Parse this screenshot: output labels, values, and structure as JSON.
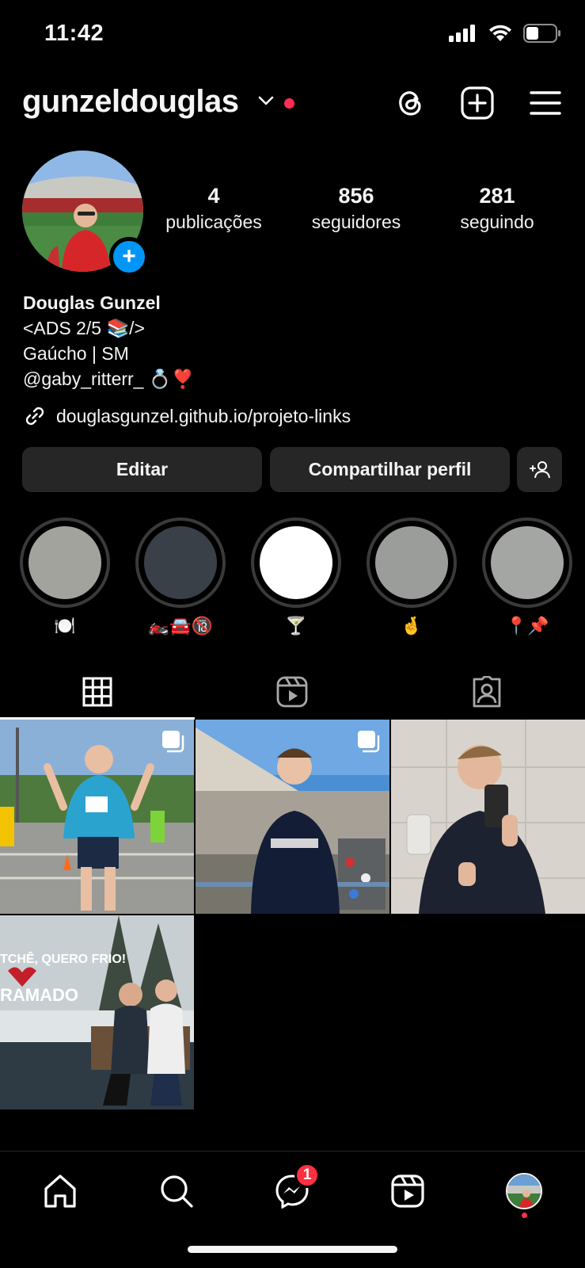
{
  "status": {
    "time": "11:42"
  },
  "header": {
    "username": "gunzeldouglas"
  },
  "profile": {
    "stats": [
      {
        "value": "4",
        "label": "publicações"
      },
      {
        "value": "856",
        "label": "seguidores"
      },
      {
        "value": "281",
        "label": "seguindo"
      }
    ],
    "name": "Douglas Gunzel",
    "bio_lines": [
      "<ADS 2/5 📚/>",
      "Gaúcho | SM",
      "@gaby_ritterr_ 💍❣️"
    ],
    "link": "douglasgunzel.github.io/projeto-links"
  },
  "buttons": {
    "edit": "Editar",
    "share": "Compartilhar perfil",
    "add_icon": "add-person-icon"
  },
  "highlights": [
    {
      "label": "🍽️",
      "color": "#a3a39d"
    },
    {
      "label": "🏍️🚘🔞",
      "color": "#3a4048"
    },
    {
      "label": "🍸",
      "color": "#ffffff"
    },
    {
      "label": "🤞",
      "color": "#9a9d9a"
    },
    {
      "label": "📍📌",
      "color": "#a4a6a3"
    }
  ],
  "tabs": [
    "grid-icon",
    "reels-icon",
    "tagged-icon"
  ],
  "nav": {
    "messages_badge": "1"
  },
  "colors": {
    "accent": "#0095f6",
    "badge": "#ff3040",
    "button_bg": "#262626"
  }
}
